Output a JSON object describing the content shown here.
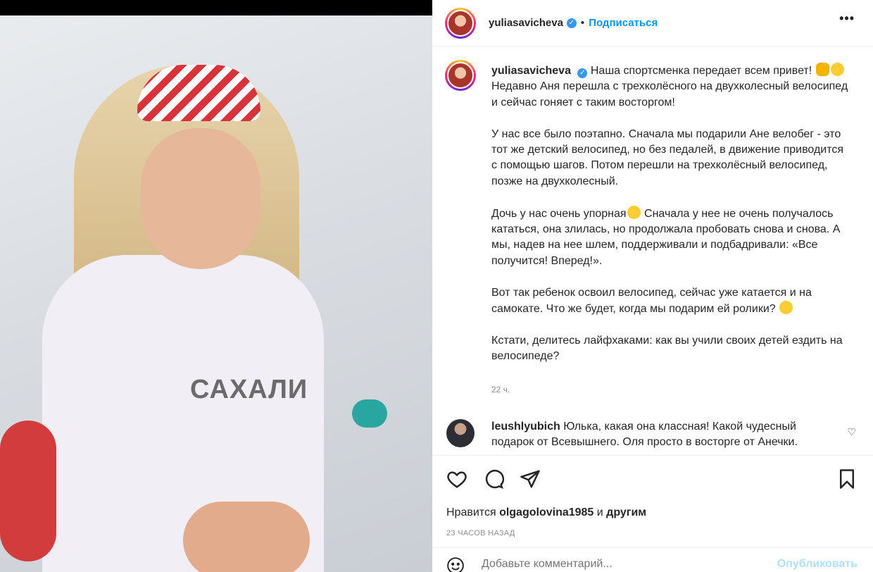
{
  "post": {
    "username": "yuliasavicheva",
    "follow_label": "Подписаться",
    "more_label": "•••",
    "caption_lines": [
      "Наша спортсменка передает всем привет!",
      "Недавно Аня перешла с трехколёсного на двухколесный велосипед и сейчас гоняет с таким восторгом!",
      "У нас все было поэтапно. Сначала мы подарили Ане велобег - это тот же детский велосипед, но без педалей, в движение приводится с помощью шагов. Потом перешли на трехколёсный велосипед, позже на двухколесный.",
      "Дочь у нас очень упорная",
      " Сначала у нее не очень получалось кататься, она злилась, но продолжала пробовать снова и снова. А мы, надев на нее шлем, поддерживали и подбадривали: «Все получится! Вперед!».",
      "Вот так ребенок освоил велосипед, сейчас уже катается и на самокате. Что же будет, когда мы подарим ей ролики?",
      "Кстати, делитесь лайфхаками: как вы учили своих детей ездить на велосипеде?"
    ],
    "time_short": "22 ч.",
    "photo_print": "САХАЛИ"
  },
  "comment": {
    "username": "leushlyubich",
    "text": "Юлька, какая она классная! Какой чудесный подарок от Всевышнего. Оля просто в восторге от Анечки."
  },
  "likes": {
    "prefix": "Нравится",
    "user": "olgagolovina1985",
    "middle": "и",
    "suffix": "другим"
  },
  "time_long": "23 ЧАСОВ НАЗАД",
  "add_comment": {
    "placeholder": "Добавьте комментарий...",
    "publish_label": "Опубликовать"
  },
  "icons": {
    "like": "heart-icon",
    "comment": "comment-icon",
    "share": "share-icon",
    "save": "bookmark-icon",
    "emoji": "emoji-icon",
    "verified": "verified-badge-icon"
  },
  "colors": {
    "link_blue": "#0095f6",
    "verified_blue": "#3897f0",
    "muted_gray": "#8e8e8e",
    "publish_disabled": "#b2dffc"
  }
}
